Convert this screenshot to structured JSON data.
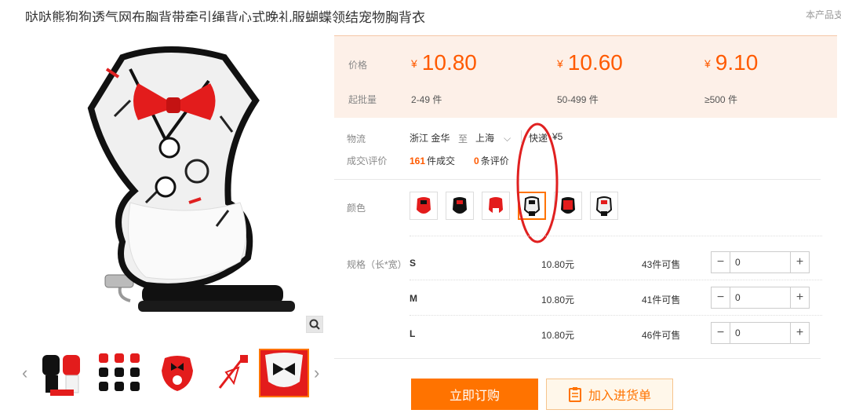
{
  "product": {
    "title": "哒哒熊狗狗透气网布胸背带牵引绳背心式晚礼服蝴蝶领结宠物胸背衣",
    "right_note": "本产品支"
  },
  "price_table": {
    "price_label": "价格",
    "qty_label": "起批量",
    "currency": "¥",
    "tiers": [
      {
        "price": "10.80",
        "range": "2-49 件"
      },
      {
        "price": "10.60",
        "range": "50-499 件"
      },
      {
        "price": "9.10",
        "range": "≥500 件"
      }
    ]
  },
  "logistics": {
    "label": "物流",
    "from": "浙江 金华",
    "to_word": "至",
    "to": "上海",
    "method": "快递",
    "fee": "¥5"
  },
  "deals": {
    "label": "成交\\评价",
    "sold_count": "161",
    "sold_text": "件成交",
    "review_count": "0",
    "review_text": "条评价"
  },
  "color": {
    "label": "颜色",
    "selected_index": 4
  },
  "specs": {
    "label": "规格（长*宽）",
    "rows": [
      {
        "size": "S",
        "price": "10.80元",
        "stock": "43件可售",
        "qty": "0"
      },
      {
        "size": "M",
        "price": "10.80元",
        "stock": "41件可售",
        "qty": "0"
      },
      {
        "size": "L",
        "price": "10.80元",
        "stock": "46件可售",
        "qty": "0"
      }
    ]
  },
  "actions": {
    "buy_label": "立即订购",
    "cart_label": "加入进货单"
  },
  "colors": {
    "accent": "#ff7300",
    "price": "#ff5a00",
    "price_bg": "#fdf0e8",
    "annotation": "#e02020"
  }
}
